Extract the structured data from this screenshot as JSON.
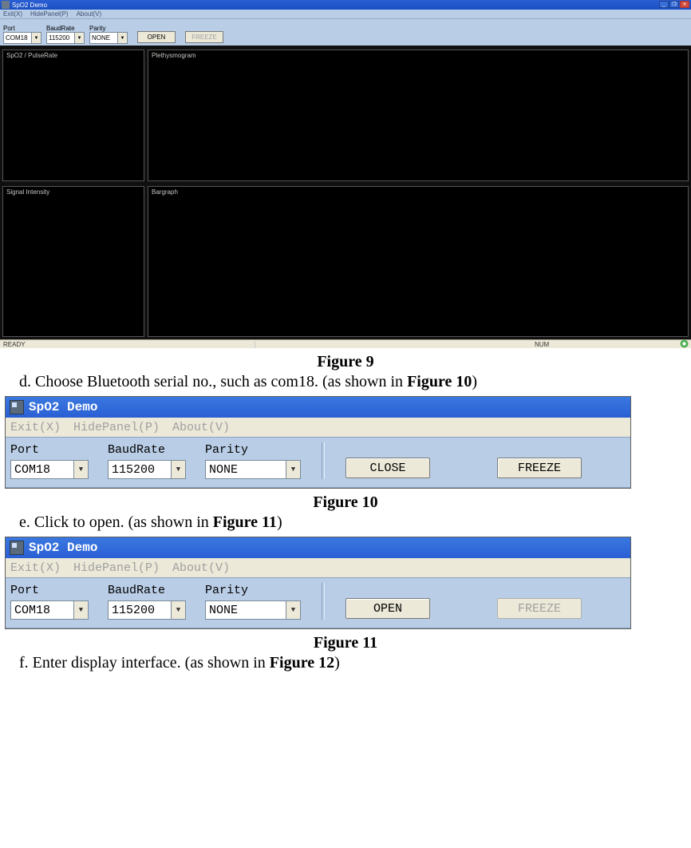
{
  "app_title": "SpO2 Demo",
  "fig9": {
    "menubar": {
      "exit": "Exit(X)",
      "hidePanel": "HidePanel(P)",
      "about": "About(V)"
    },
    "toolbar": {
      "port_label": "Port",
      "port_value": "COM18",
      "baud_label": "BaudRate",
      "baud_value": "115200",
      "parity_label": "Parity",
      "parity_value": "NONE",
      "open_btn": "OPEN",
      "freeze_btn": "FREEZE"
    },
    "panels": {
      "p1": "SpO2 / PulseRate",
      "p2": "Plethysmogram",
      "p3": "Signal Intensity",
      "p4": "Bargraph"
    },
    "status": {
      "ready": "READY",
      "num": "NUM"
    }
  },
  "crop": {
    "menubar": {
      "exit": "Exit(X)",
      "hidePanel": "HidePanel(P)",
      "about": "About(V)"
    },
    "port_label": "Port",
    "port_value": "COM18",
    "baud_label": "BaudRate",
    "baud_value": "115200",
    "parity_label": "Parity",
    "parity_value": "NONE",
    "close_btn": "CLOSE",
    "open_btn": "OPEN",
    "freeze_btn": "FREEZE"
  },
  "captions": {
    "fig9": "Figure 9",
    "fig10": "Figure 10",
    "fig11": "Figure 11"
  },
  "steps": {
    "d_pre": "d. Choose Bluetooth serial no., such as com18. (as shown in ",
    "d_bold": "Figure 10",
    "d_post": ")",
    "e_pre": "e. Click to open. (as shown in ",
    "e_bold": "Figure 11",
    "e_post": ")",
    "f_pre": "f. Enter display interface. (as shown in ",
    "f_bold": "Figure 12",
    "f_post": ")"
  }
}
